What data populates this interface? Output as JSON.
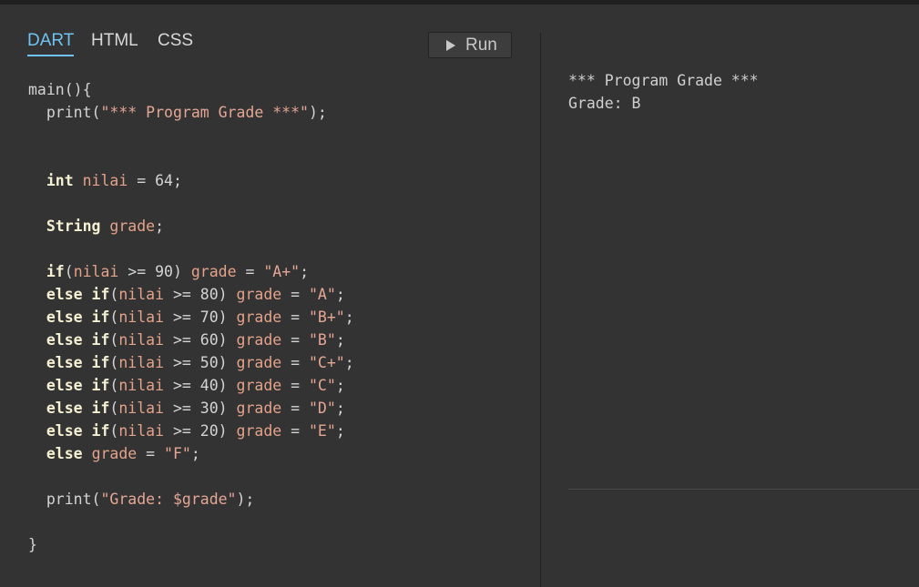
{
  "tabs": [
    {
      "label": "DART",
      "active": true
    },
    {
      "label": "HTML",
      "active": false
    },
    {
      "label": "CSS",
      "active": false
    }
  ],
  "run_button": {
    "label": "Run",
    "icon": "play-icon"
  },
  "colors": {
    "accent": "#6fc3f2",
    "background": "#333333",
    "keyword": "#f5f0d2",
    "string": "#e4a695",
    "identifier": "#e3a28a"
  },
  "editor": {
    "language": "dart",
    "lines": [
      [
        {
          "t": "p",
          "s": "main(){"
        }
      ],
      [
        {
          "t": "p",
          "s": "  print("
        },
        {
          "t": "s",
          "s": "\"*** Program Grade ***\""
        },
        {
          "t": "p",
          "s": ");"
        }
      ],
      [],
      [],
      [
        {
          "t": "p",
          "s": "  "
        },
        {
          "t": "k",
          "s": "int"
        },
        {
          "t": "p",
          "s": " "
        },
        {
          "t": "i",
          "s": "nilai"
        },
        {
          "t": "p",
          "s": " = 64;"
        }
      ],
      [],
      [
        {
          "t": "p",
          "s": "  "
        },
        {
          "t": "k",
          "s": "String"
        },
        {
          "t": "p",
          "s": " "
        },
        {
          "t": "i",
          "s": "grade"
        },
        {
          "t": "p",
          "s": ";"
        }
      ],
      [],
      [
        {
          "t": "p",
          "s": "  "
        },
        {
          "t": "k",
          "s": "if"
        },
        {
          "t": "p",
          "s": "("
        },
        {
          "t": "i",
          "s": "nilai"
        },
        {
          "t": "p",
          "s": " >= 90) "
        },
        {
          "t": "i",
          "s": "grade"
        },
        {
          "t": "p",
          "s": " = "
        },
        {
          "t": "s",
          "s": "\"A+\""
        },
        {
          "t": "p",
          "s": ";"
        }
      ],
      [
        {
          "t": "p",
          "s": "  "
        },
        {
          "t": "k",
          "s": "else if"
        },
        {
          "t": "p",
          "s": "("
        },
        {
          "t": "i",
          "s": "nilai"
        },
        {
          "t": "p",
          "s": " >= 80) "
        },
        {
          "t": "i",
          "s": "grade"
        },
        {
          "t": "p",
          "s": " = "
        },
        {
          "t": "s",
          "s": "\"A\""
        },
        {
          "t": "p",
          "s": ";"
        }
      ],
      [
        {
          "t": "p",
          "s": "  "
        },
        {
          "t": "k",
          "s": "else if"
        },
        {
          "t": "p",
          "s": "("
        },
        {
          "t": "i",
          "s": "nilai"
        },
        {
          "t": "p",
          "s": " >= 70) "
        },
        {
          "t": "i",
          "s": "grade"
        },
        {
          "t": "p",
          "s": " = "
        },
        {
          "t": "s",
          "s": "\"B+\""
        },
        {
          "t": "p",
          "s": ";"
        }
      ],
      [
        {
          "t": "p",
          "s": "  "
        },
        {
          "t": "k",
          "s": "else if"
        },
        {
          "t": "p",
          "s": "("
        },
        {
          "t": "i",
          "s": "nilai"
        },
        {
          "t": "p",
          "s": " >= 60) "
        },
        {
          "t": "i",
          "s": "grade"
        },
        {
          "t": "p",
          "s": " = "
        },
        {
          "t": "s",
          "s": "\"B\""
        },
        {
          "t": "p",
          "s": ";"
        }
      ],
      [
        {
          "t": "p",
          "s": "  "
        },
        {
          "t": "k",
          "s": "else if"
        },
        {
          "t": "p",
          "s": "("
        },
        {
          "t": "i",
          "s": "nilai"
        },
        {
          "t": "p",
          "s": " >= 50) "
        },
        {
          "t": "i",
          "s": "grade"
        },
        {
          "t": "p",
          "s": " = "
        },
        {
          "t": "s",
          "s": "\"C+\""
        },
        {
          "t": "p",
          "s": ";"
        }
      ],
      [
        {
          "t": "p",
          "s": "  "
        },
        {
          "t": "k",
          "s": "else if"
        },
        {
          "t": "p",
          "s": "("
        },
        {
          "t": "i",
          "s": "nilai"
        },
        {
          "t": "p",
          "s": " >= 40) "
        },
        {
          "t": "i",
          "s": "grade"
        },
        {
          "t": "p",
          "s": " = "
        },
        {
          "t": "s",
          "s": "\"C\""
        },
        {
          "t": "p",
          "s": ";"
        }
      ],
      [
        {
          "t": "p",
          "s": "  "
        },
        {
          "t": "k",
          "s": "else if"
        },
        {
          "t": "p",
          "s": "("
        },
        {
          "t": "i",
          "s": "nilai"
        },
        {
          "t": "p",
          "s": " >= 30) "
        },
        {
          "t": "i",
          "s": "grade"
        },
        {
          "t": "p",
          "s": " = "
        },
        {
          "t": "s",
          "s": "\"D\""
        },
        {
          "t": "p",
          "s": ";"
        }
      ],
      [
        {
          "t": "p",
          "s": "  "
        },
        {
          "t": "k",
          "s": "else if"
        },
        {
          "t": "p",
          "s": "("
        },
        {
          "t": "i",
          "s": "nilai"
        },
        {
          "t": "p",
          "s": " >= 20) "
        },
        {
          "t": "i",
          "s": "grade"
        },
        {
          "t": "p",
          "s": " = "
        },
        {
          "t": "s",
          "s": "\"E\""
        },
        {
          "t": "p",
          "s": ";"
        }
      ],
      [
        {
          "t": "p",
          "s": "  "
        },
        {
          "t": "k",
          "s": "else"
        },
        {
          "t": "p",
          "s": " "
        },
        {
          "t": "i",
          "s": "grade"
        },
        {
          "t": "p",
          "s": " = "
        },
        {
          "t": "s",
          "s": "\"F\""
        },
        {
          "t": "p",
          "s": ";"
        }
      ],
      [],
      [
        {
          "t": "p",
          "s": "  print("
        },
        {
          "t": "s",
          "s": "\"Grade: $grade\""
        },
        {
          "t": "p",
          "s": ");"
        }
      ],
      [],
      [
        {
          "t": "p",
          "s": "}"
        }
      ]
    ]
  },
  "output": {
    "lines": [
      "*** Program Grade ***",
      "Grade: B"
    ]
  }
}
